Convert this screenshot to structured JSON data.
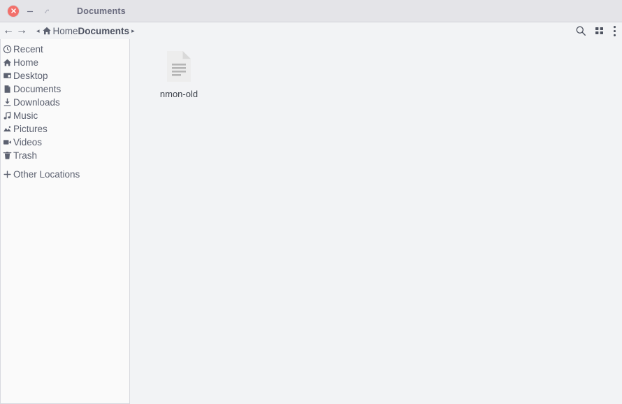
{
  "window": {
    "title": "Documents",
    "controls": {
      "close_label": "×",
      "minimize_label": "–",
      "maximize_label": "⇱"
    }
  },
  "toolbar": {
    "back_label": "←",
    "forward_label": "→",
    "left_triangle": "◂",
    "right_triangle": "▸",
    "breadcrumbs": [
      {
        "label": "Home",
        "bold": false
      },
      {
        "label": "Documents",
        "bold": true
      }
    ],
    "icons": [
      {
        "name": "search-icon",
        "title": "Search"
      },
      {
        "name": "view-grid-icon",
        "title": "View options"
      },
      {
        "name": "menu-kebab-icon",
        "title": "Menu"
      }
    ]
  },
  "sidebar": {
    "items": [
      {
        "label": "Recent",
        "icon": "clock-icon"
      },
      {
        "label": "Home",
        "icon": "home-icon"
      },
      {
        "label": "Desktop",
        "icon": "desktop-icon"
      },
      {
        "label": "Documents",
        "icon": "document-icon"
      },
      {
        "label": "Downloads",
        "icon": "download-icon"
      },
      {
        "label": "Music",
        "icon": "music-note-icon"
      },
      {
        "label": "Pictures",
        "icon": "image-icon"
      },
      {
        "label": "Videos",
        "icon": "video-camera-icon"
      },
      {
        "label": "Trash",
        "icon": "trash-icon"
      }
    ],
    "other_locations": {
      "label": "Other Locations",
      "icon": "plus-icon"
    }
  },
  "content": {
    "files": [
      {
        "name": "nmon-old",
        "icon": "text-document-icon"
      }
    ]
  },
  "colors": {
    "titlebar_bg": "#e4e4e8",
    "content_bg": "#f2f3f5",
    "sidebar_bg": "#fafafa",
    "close_button": "#f2706b",
    "text": "#5c6170"
  }
}
